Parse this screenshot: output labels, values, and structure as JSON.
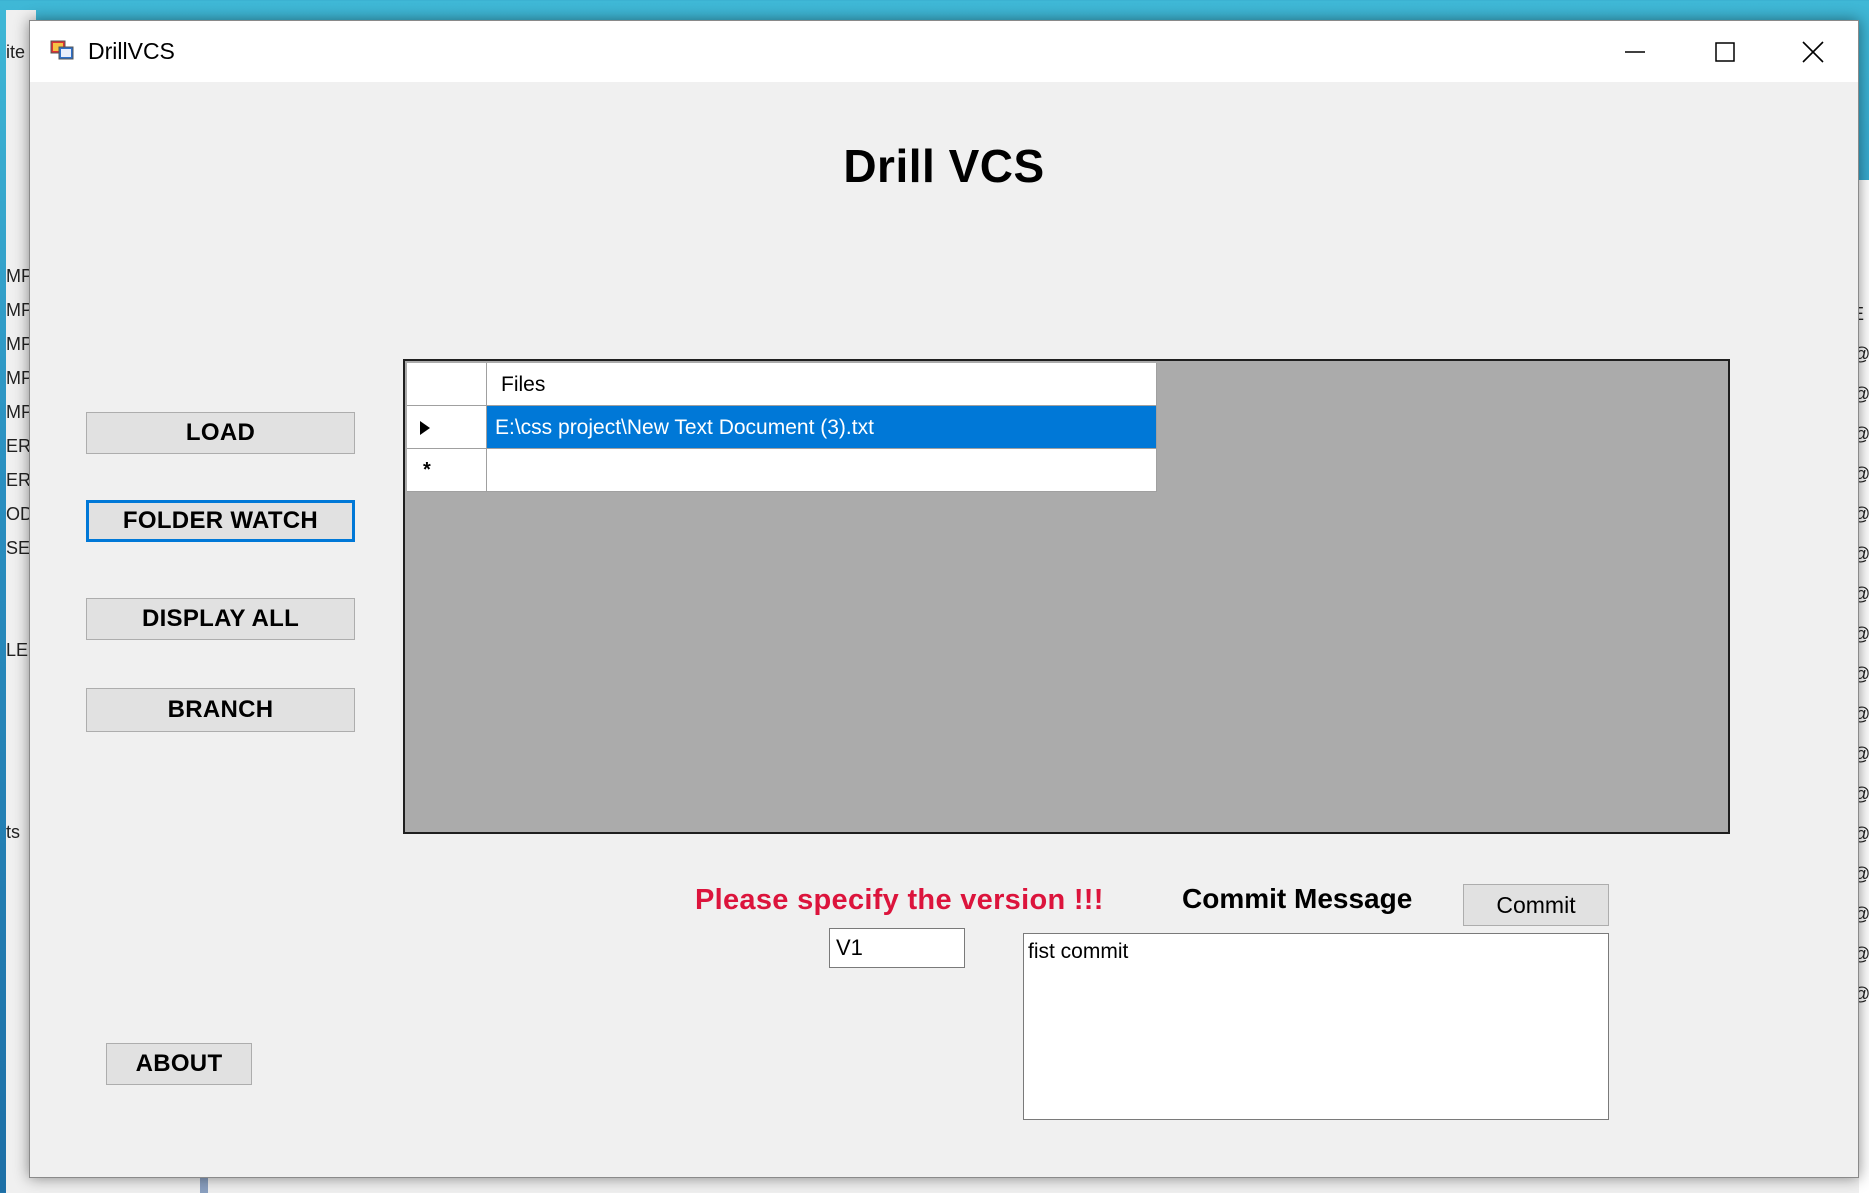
{
  "window": {
    "title": "DrillVCS",
    "app_heading": "Drill VCS"
  },
  "sidebar": {
    "load_label": "LOAD",
    "folder_watch_label": "FOLDER WATCH",
    "display_all_label": "DISPLAY ALL",
    "branch_label": "BRANCH",
    "about_label": "ABOUT"
  },
  "grid": {
    "column_header": "Files",
    "rows": [
      {
        "value": "E:\\css project\\New Text Document (3).txt",
        "selected": true
      }
    ],
    "row_indicator": "▶",
    "new_row_indicator": "*"
  },
  "commit": {
    "warning": "Please specify the version !!!",
    "message_label": "Commit Message",
    "button_label": "Commit",
    "version_value": "V1",
    "message_value": "fist commit"
  },
  "background_fragments": {
    "left": [
      "ite",
      "MP",
      "MP",
      "MP",
      "MP",
      "MP",
      "ER",
      "ER",
      "OD",
      "SE",
      "LE",
      "ts"
    ],
    "right": [
      "E",
      "@",
      "@",
      "@",
      "@",
      "@",
      "@",
      "@",
      "@",
      "@",
      "@",
      "@",
      "@",
      "@",
      "@",
      "@",
      "@",
      "@"
    ]
  },
  "colors": {
    "accent": "#0078d7",
    "warning": "#dc143c",
    "grid_bg": "#ababab",
    "form_bg": "#f0f0f0"
  }
}
